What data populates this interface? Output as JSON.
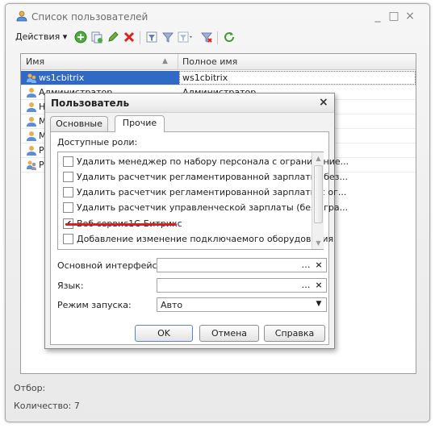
{
  "window": {
    "title": "Список пользователей",
    "controls": [
      "_",
      "□",
      "×"
    ]
  },
  "toolbar": {
    "actions_label": "Действия ▾",
    "icons": [
      "add-icon",
      "copy-icon",
      "edit-icon",
      "delete-icon",
      "filter-icon",
      "filter-list-icon",
      "filter-dropdown-icon",
      "clear-filter-icon",
      "refresh-icon"
    ]
  },
  "list": {
    "columns": [
      "Имя",
      "Полное имя"
    ],
    "rows": [
      {
        "name": "ws1cbitrix",
        "full": "ws1cbitrix",
        "selected": true
      },
      {
        "name": "Администратор",
        "full": "Администратор"
      },
      {
        "name": "Н",
        "full": ""
      },
      {
        "name": "М",
        "full": ""
      },
      {
        "name": "М",
        "full": ""
      },
      {
        "name": "Р",
        "full": ""
      },
      {
        "name": "Р",
        "full": ""
      }
    ]
  },
  "footer": {
    "filter": "Отбор:",
    "count": "Количество: 7"
  },
  "dialog": {
    "title": "Пользователь",
    "close": "×",
    "tabs": [
      "Основные",
      "Прочие"
    ],
    "active_tab": "Прочие",
    "roles_label": "Доступные роли:",
    "roles": [
      {
        "label": "Удалить менеджер по набору персонала с ограничение...",
        "checked": false
      },
      {
        "label": "Удалить расчетчик регламентированной зарплаты (без...",
        "checked": false
      },
      {
        "label": "Удалить расчетчик регламентированной зарплаты с ог...",
        "checked": false
      },
      {
        "label": "Удалить расчетчик управленческой зарплаты (без огра...",
        "checked": false
      },
      {
        "label": "Веб сервис1С-Битрикс",
        "checked": true
      },
      {
        "label": "Добавление изменение подключаемого оборудования",
        "checked": false
      }
    ],
    "main_interface_label": "Основной интерфейс:",
    "main_interface_value": "",
    "language_label": "Язык:",
    "language_value": "",
    "launch_mode_label": "Режим запуска:",
    "launch_mode_value": "Авто",
    "buttons": {
      "ok": "OK",
      "cancel": "Отмена",
      "help": "Справка"
    },
    "highlight_color": "#d82020"
  }
}
